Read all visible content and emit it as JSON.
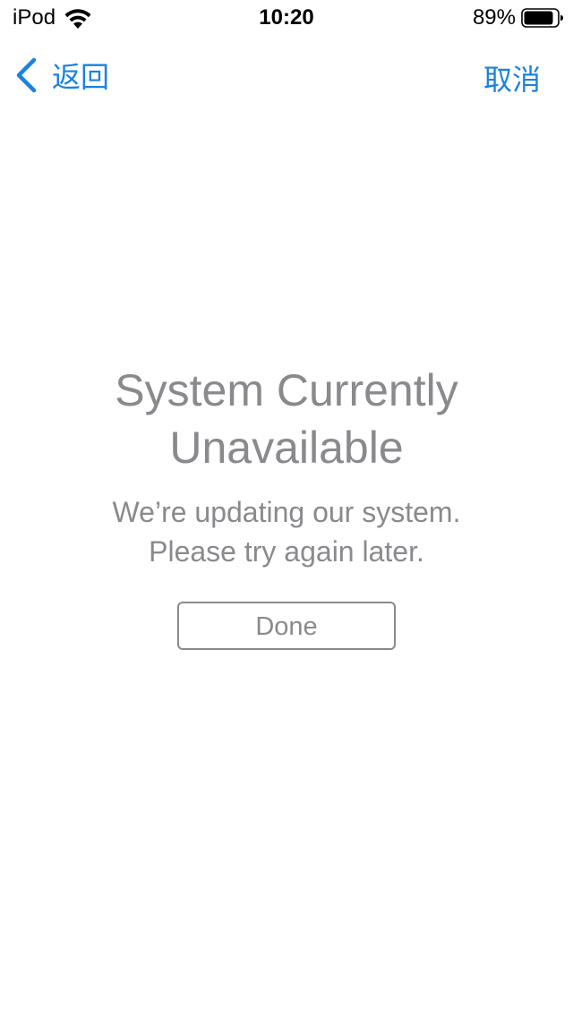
{
  "status_bar": {
    "carrier": "iPod",
    "time": "10:20",
    "battery_percent": "89%",
    "battery_level": 0.89,
    "wifi_icon": "wifi-icon",
    "battery_icon": "battery-icon"
  },
  "nav": {
    "back_label": "返回",
    "back_icon": "chevron-left-icon",
    "cancel_label": "取消",
    "accent_color": "#1a82e2"
  },
  "content": {
    "title": "System Currently Unavailable",
    "message_line1": "We’re updating our system.",
    "message_line2": "Please try again later.",
    "done_label": "Done",
    "text_color": "#8a8a8e"
  }
}
